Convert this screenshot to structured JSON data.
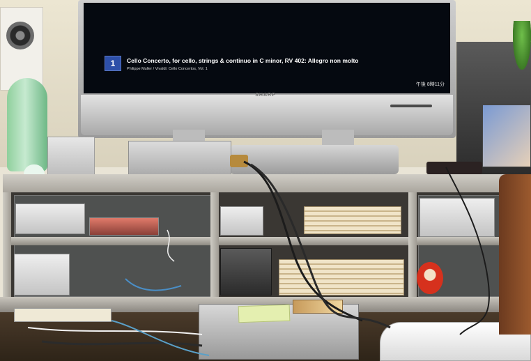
{
  "tv": {
    "brand": "SHARP",
    "track_number": "1",
    "track_title": "Cello Concerto, for cello, strings & continuo in C minor, RV 402: Allegro non molto",
    "track_subtitle": "Philippe Muller / Vivaldi: Cello Concertos, Vol. 1",
    "clock": "午後 8時11分"
  },
  "colors": {
    "screen": "#050910",
    "track_badge": "#2d4fa8",
    "iron": "#8fcf9c",
    "daruma": "#d6311d"
  },
  "objects": [
    "speaker-icon",
    "flat-screen-tv",
    "steam-iron",
    "audio-amplifier",
    "audio-shelf",
    "power-strip",
    "game-console",
    "daruma-doll",
    "cd-case",
    "remote-control"
  ]
}
